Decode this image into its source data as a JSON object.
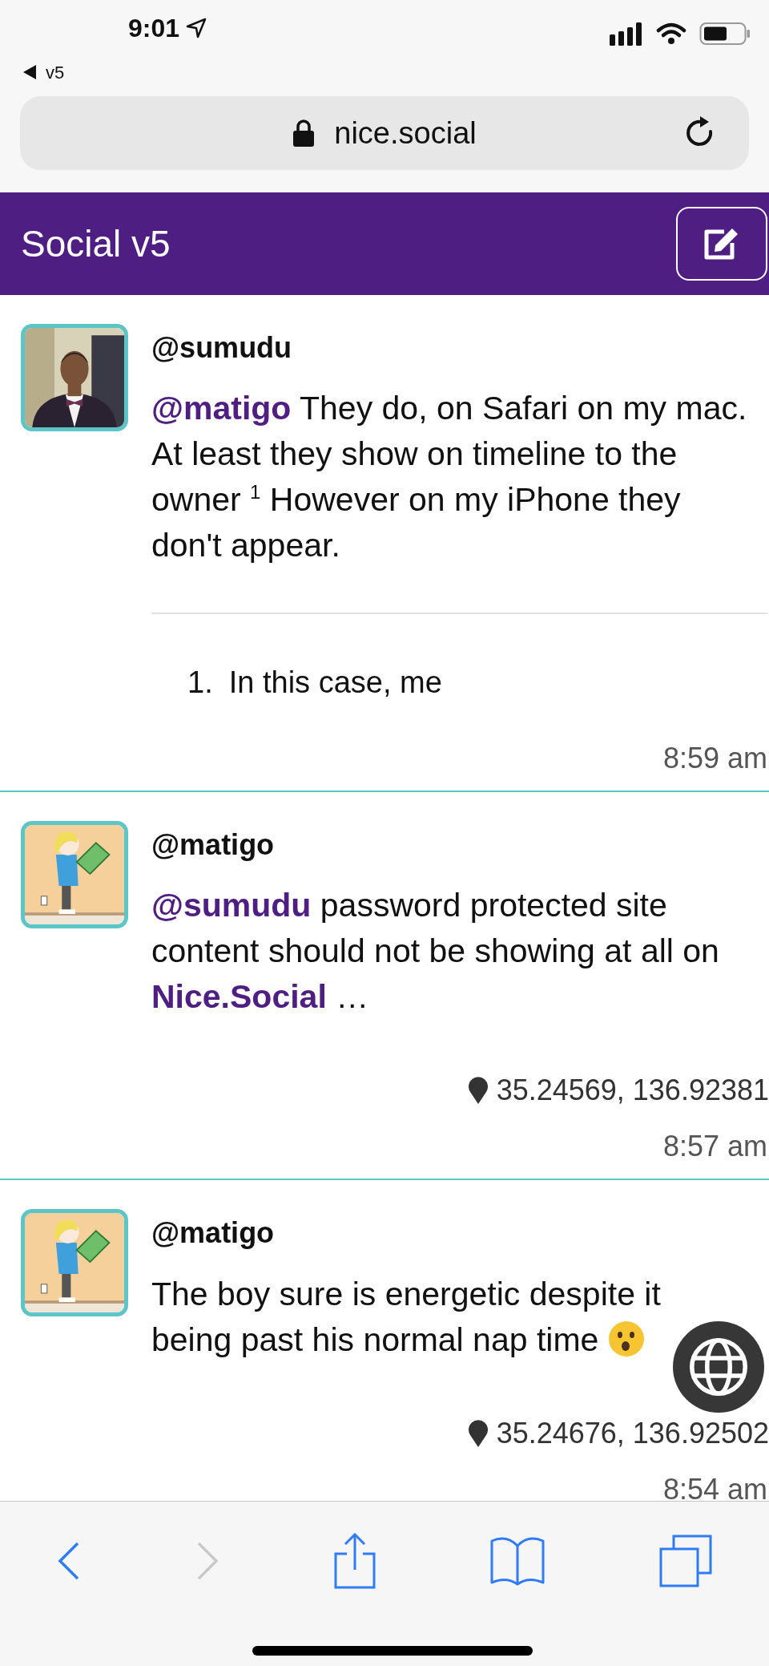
{
  "status_bar": {
    "time": "9:01",
    "back_app": "v5"
  },
  "browser": {
    "url": "nice.social"
  },
  "header": {
    "title": "Social v5"
  },
  "posts": [
    {
      "username": "@sumudu",
      "avatar": {
        "kind": "picture"
      },
      "body": [
        {
          "kind": "mention",
          "text": "@matigo"
        },
        {
          "kind": "text",
          "text": " They do, on Safari on my mac. At least they show on timeline to the owner "
        },
        {
          "kind": "footnote",
          "text": "1"
        },
        {
          "kind": "text",
          "text": " However on my iPhone they don't appear."
        }
      ],
      "footnotes": [
        {
          "number": "1.",
          "text": "In this case, me"
        }
      ],
      "time": "8:59 am"
    },
    {
      "username": "@matigo",
      "avatar": {
        "kind": "picture"
      },
      "body": [
        {
          "kind": "mention",
          "text": "@sumudu"
        },
        {
          "kind": "text",
          "text": " password protected site content should not be showing at all on "
        },
        {
          "kind": "mention",
          "text": "Nice.Social"
        },
        {
          "kind": "text",
          "text": " …"
        }
      ],
      "location": "35.24569, 136.92381",
      "time": "8:57 am"
    },
    {
      "username": "@matigo",
      "avatar": {
        "kind": "picture"
      },
      "body": [
        {
          "kind": "text",
          "text": "The boy sure is energetic despite it being past his normal nap time "
        },
        {
          "kind": "emoji"
        }
      ],
      "location": "35.24676, 136.92502",
      "time": "8:54 am"
    }
  ],
  "toolbar": {
    "back": {
      "disabled": false
    },
    "forward": {
      "disabled": true
    }
  }
}
